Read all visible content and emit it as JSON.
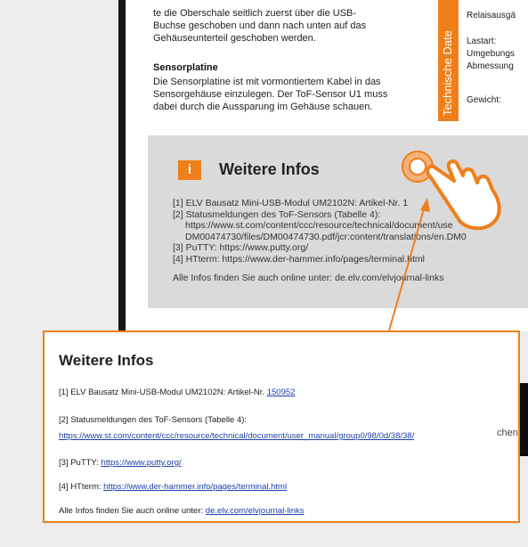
{
  "page": {
    "intro_lines": [
      "te die Oberschale seitlich zuerst über die USB-",
      "Buchse geschoben und dann nach unten auf das",
      "Gehäuseunterteil geschoben werden."
    ],
    "sensor_heading": "Sensorplatine",
    "sensor_lines": [
      "Die Sensorplatine ist mit vormontiertem Kabel in das",
      "Sensorgehäuse einzulegen. Der ToF-Sensor U1 muss",
      "dabei durch die Aussparung im Gehäuse schauen."
    ],
    "tech_tab": "Technische Date",
    "tech_rows": [
      "Relaisausgä",
      "Lastart:",
      "Umgebungs",
      "Abmessung",
      "Gewicht:"
    ]
  },
  "infobox": {
    "icon_glyph": "i",
    "title": "Weitere Infos",
    "items": [
      "[1]  ELV Bausatz Mini-USB-Modul UM2102N: Artikel-Nr. 1",
      "[2]  Statusmeldungen des ToF-Sensors (Tabelle 4):",
      "https://www.st.com/content/ccc/resource/technical/document/use",
      "DM00474730/files/DM00474730.pdf/jcr:content/translations/en.DM0",
      "[3]  PuTTY: https://www.putty.org/",
      "[4]  HTterm: https://www.der-hammer.info/pages/terminal.html"
    ],
    "footer": "Alle Infos finden Sie auch online unter: de.elv.com/elvjournal-links"
  },
  "callout": {
    "title": "Weitere Infos",
    "item1_prefix": "[1] ELV Bausatz Mini-USB-Modul UM2102N: Artikel-Nr. ",
    "item1_link": "150952",
    "item2_text": "[2] Statusmeldungen des ToF-Sensors (Tabelle 4):",
    "item2_link": "https://www.st.com/content/ccc/resource/technical/document/user_manual/group0/98/0d/38/38/",
    "item3_prefix": "[3] PuTTY: ",
    "item3_link": "https://www.putty.org/",
    "item4_prefix": "[4] HTterm: ",
    "item4_link": "https://www.der-hammer.info/pages/terminal.html",
    "footer_prefix": "Alle Infos finden Sie auch online unter: ",
    "footer_link": "de.elv.com/elvjournal-links",
    "spillover": "chen"
  },
  "colors": {
    "accent": "#ee7f1a",
    "link": "#1f40a8",
    "infobox_bg": "#dadada"
  },
  "icons": {
    "info": "info-icon",
    "pointer": "hand-pointer-icon"
  }
}
